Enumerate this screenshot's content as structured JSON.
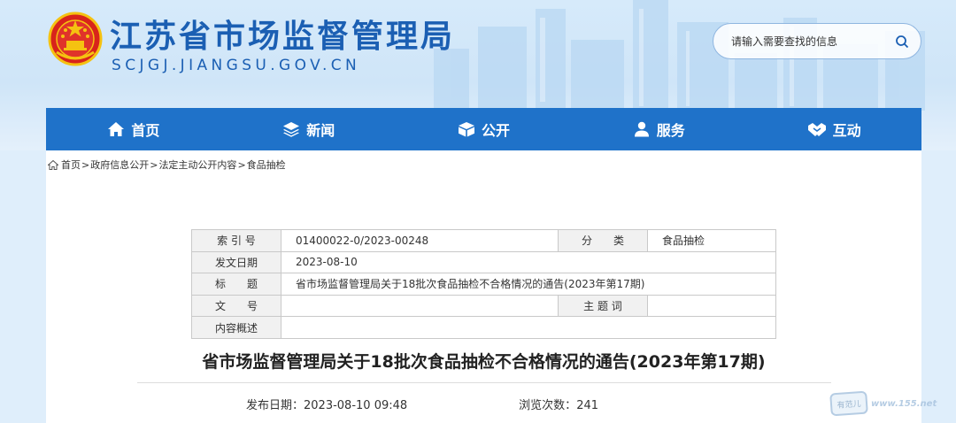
{
  "header": {
    "title": "江苏省市场监督管理局",
    "domain": "SCJGJ.JIANGSU.GOV.CN",
    "search_placeholder": "请输入需要查找的信息"
  },
  "nav": {
    "items": [
      {
        "label": "首页",
        "icon": "home-icon"
      },
      {
        "label": "新闻",
        "icon": "layers-icon"
      },
      {
        "label": "公开",
        "icon": "box-icon"
      },
      {
        "label": "服务",
        "icon": "user-icon"
      },
      {
        "label": "互动",
        "icon": "handshake-icon"
      }
    ]
  },
  "breadcrumb": {
    "items": [
      "首页",
      "政府信息公开",
      "法定主动公开内容",
      "食品抽检"
    ],
    "separator": ">"
  },
  "meta_table": {
    "index_label": "索 引 号",
    "index_value": "01400022-0/2023-00248",
    "category_label": "分　　类",
    "category_value": "食品抽检",
    "date_label": "发文日期",
    "date_value": "2023-08-10",
    "title_label": "标　　题",
    "title_value": "省市场监督管理局关于18批次食品抽检不合格情况的通告(2023年第17期)",
    "docno_label": "文　　号",
    "docno_value": "",
    "keywords_label": "主 题 词",
    "keywords_value": "",
    "summary_label": "内容概述",
    "summary_value": ""
  },
  "article": {
    "title": "省市场监督管理局关于18批次食品抽检不合格情况的通告(2023年第17期)",
    "publish_label": "发布日期：",
    "publish_value": "2023-08-10 09:48",
    "views_label": "浏览次数：",
    "views_value": "241"
  },
  "watermark": {
    "badge": "有范儿",
    "text": "www.155.net"
  },
  "colors": {
    "brand_blue": "#1f72c9",
    "title_blue": "#1b5fb3",
    "emblem_red": "#d8241b",
    "emblem_gold": "#f5c211"
  }
}
